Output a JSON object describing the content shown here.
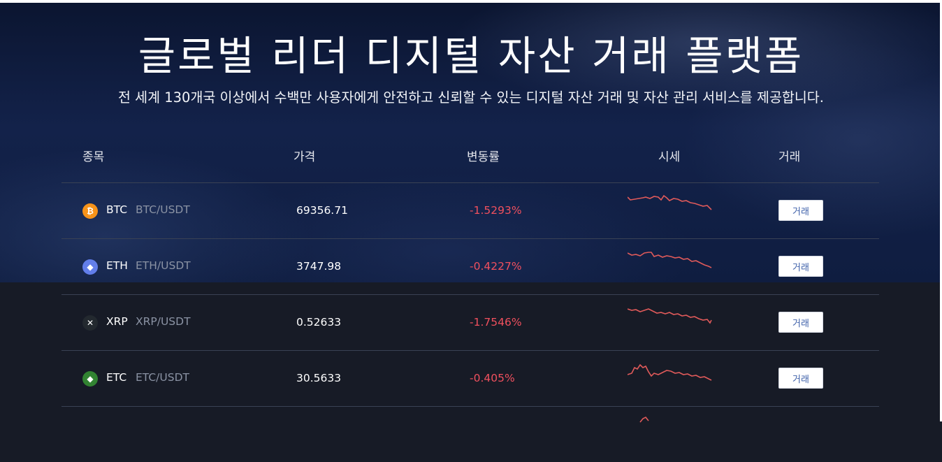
{
  "hero": {
    "title": "글로벌 리더 디지털 자산 거래 플랫폼",
    "subtitle": "전 세계 130개국 이상에서 수백만 사용자에게 안전하고 신뢰할 수 있는 디지털 자산 거래 및 자산 관리 서비스를 제공합니다."
  },
  "table": {
    "headers": {
      "symbol": "종목",
      "price": "가격",
      "change": "변동률",
      "chart": "시세",
      "trade": "거래"
    },
    "rows": [
      {
        "symbol": "BTC",
        "pair": "BTC/USDT",
        "price": "69356.71",
        "change": "-1.5293%",
        "icon": "bitcoin-icon",
        "icon_color": "#f7931a",
        "glyph": "₿",
        "trade_label": "거래"
      },
      {
        "symbol": "ETH",
        "pair": "ETH/USDT",
        "price": "3747.98",
        "change": "-0.4227%",
        "icon": "ethereum-icon",
        "icon_color": "#627eea",
        "glyph": "◆",
        "trade_label": "거래"
      },
      {
        "symbol": "XRP",
        "pair": "XRP/USDT",
        "price": "0.52633",
        "change": "-1.7546%",
        "icon": "xrp-icon",
        "icon_color": "#23292f",
        "glyph": "✕",
        "trade_label": "거래"
      },
      {
        "symbol": "ETC",
        "pair": "ETC/USDT",
        "price": "30.5633",
        "change": "-0.405%",
        "icon": "ethereum-classic-icon",
        "icon_color": "#328332",
        "glyph": "◆",
        "trade_label": "거래"
      }
    ]
  },
  "colors": {
    "negative": "#f0505e",
    "spark_line": "#e05a5a",
    "trade_text": "#3b5ea8"
  }
}
